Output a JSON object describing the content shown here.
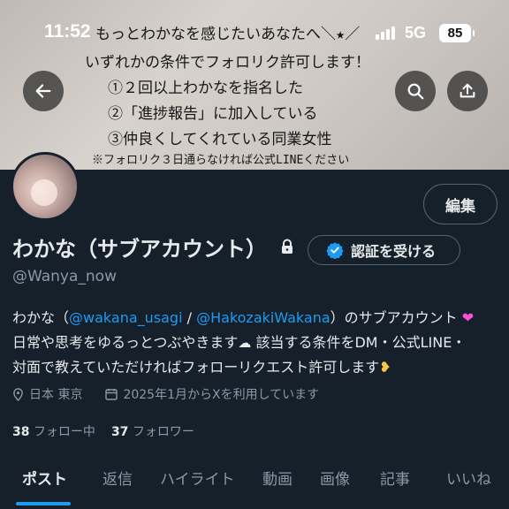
{
  "status_bar": {
    "time": "11:52",
    "network": "5G",
    "battery": "85"
  },
  "banner": {
    "lines": [
      "もっとわかなを感じたいあなたへ＼★／",
      "いずれかの条件でフォロリク許可します！",
      "①２回以上わかなを指名した",
      "②「進捗報告」に加入している",
      "③仲良くしてくれている同業女性",
      "※フォロリク３日通らなければ公式LINEください"
    ]
  },
  "buttons": {
    "edit": "編集",
    "verify": "認証を受ける"
  },
  "profile": {
    "name": "わかな（サブアカウント）",
    "handle": "@Wanya_now",
    "bio": {
      "l1_a": "わかな（",
      "mention1": "@wakana_usagi",
      "l1_sep": " / ",
      "mention2": "@HakozakiWakana",
      "l1_b": "）のサブアカウント",
      "l2": "日常や思考をゆるっとつぶやきます",
      "l2_b": " 該当する条件をDM・公式LINE・",
      "l3": "対面で教えていただければフォローリクエスト許可します"
    },
    "location": "日本 東京",
    "joined": "2025年1月からXを利用しています",
    "following_count": "38",
    "following_label": "フォロー中",
    "followers_count": "37",
    "followers_label": "フォロワー"
  },
  "tabs": [
    "ポスト",
    "返信",
    "ハイライト",
    "動画",
    "画像",
    "記事",
    "いいね"
  ],
  "colors": {
    "background": "#15202b",
    "accent": "#1d9bf0",
    "secondary_text": "#8b98a5"
  }
}
